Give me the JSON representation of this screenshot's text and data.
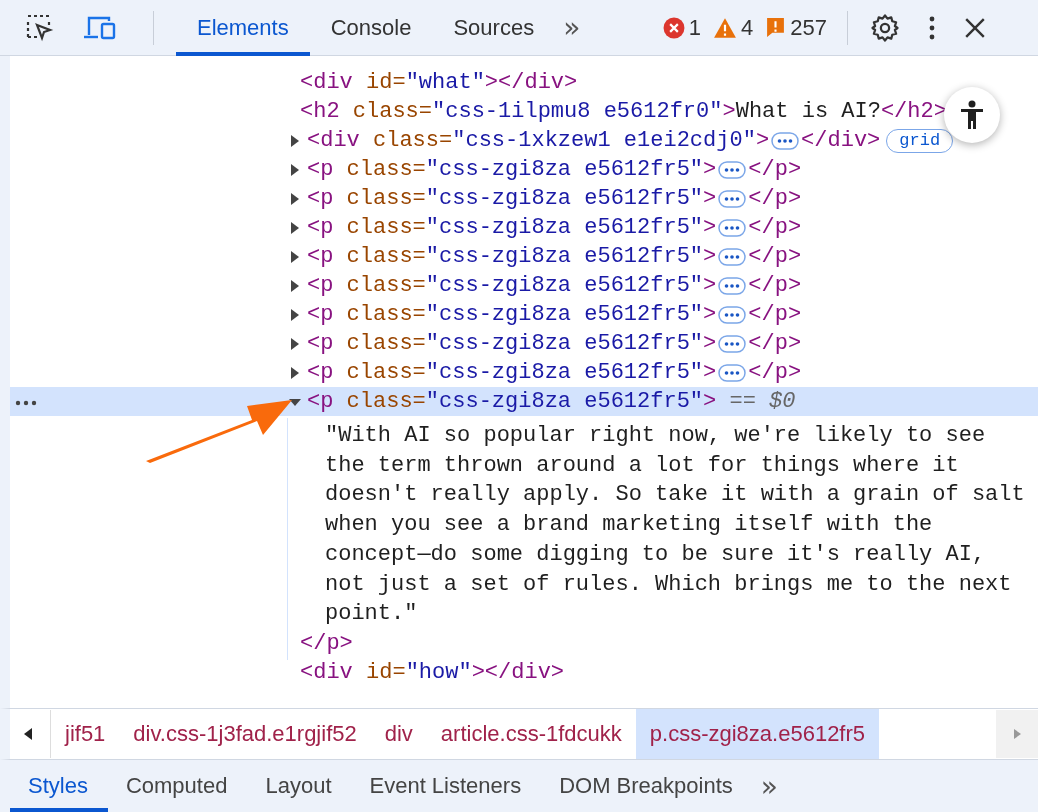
{
  "toolbar": {
    "tabs": [
      {
        "label": "Elements",
        "selected": true
      },
      {
        "label": "Console",
        "selected": false
      },
      {
        "label": "Sources",
        "selected": false
      }
    ],
    "more": "»",
    "errors": "1",
    "warnings": "4",
    "issues": "257"
  },
  "dom_lines": [
    {
      "kind": "element",
      "selected": false,
      "tokens": [
        {
          "kind": "tag",
          "s": "<div"
        },
        {
          "kind": "attr",
          "s": " id="
        },
        {
          "kind": "value",
          "s": "\"what\""
        },
        {
          "kind": "tag",
          "s": "></div>"
        }
      ]
    },
    {
      "kind": "element",
      "selected": false,
      "tokens": [
        {
          "kind": "tag",
          "s": "<h2"
        },
        {
          "kind": "attr",
          "s": " class="
        },
        {
          "kind": "value",
          "s": "\"css-1ilpmu8 e5612fr0\""
        },
        {
          "kind": "tag",
          "s": ">"
        },
        {
          "kind": "text",
          "s": "What is AI?"
        },
        {
          "kind": "tag",
          "s": "</h2>"
        }
      ]
    },
    {
      "kind": "element",
      "selected": false,
      "expanded": false,
      "tokens": [
        {
          "kind": "tag",
          "s": "<div"
        },
        {
          "kind": "attr",
          "s": " class="
        },
        {
          "kind": "value",
          "s": "\"css-1xkzew1 e1ei2cdj0\""
        },
        {
          "kind": "tag",
          "s": ">"
        },
        {
          "kind": "ellipsis"
        },
        {
          "kind": "tag",
          "s": "</div>"
        },
        {
          "kind": "badge",
          "s": "grid"
        }
      ]
    },
    {
      "kind": "element",
      "selected": false,
      "expanded": false,
      "tokens": [
        {
          "kind": "tag",
          "s": "<p"
        },
        {
          "kind": "attr",
          "s": " class="
        },
        {
          "kind": "value",
          "s": "\"css-zgi8za e5612fr5\""
        },
        {
          "kind": "tag",
          "s": ">"
        },
        {
          "kind": "ellipsis"
        },
        {
          "kind": "tag",
          "s": "</p>"
        }
      ]
    },
    {
      "kind": "element",
      "selected": false,
      "expanded": false,
      "tokens": [
        {
          "kind": "tag",
          "s": "<p"
        },
        {
          "kind": "attr",
          "s": " class="
        },
        {
          "kind": "value",
          "s": "\"css-zgi8za e5612fr5\""
        },
        {
          "kind": "tag",
          "s": ">"
        },
        {
          "kind": "ellipsis"
        },
        {
          "kind": "tag",
          "s": "</p>"
        }
      ]
    },
    {
      "kind": "element",
      "selected": false,
      "expanded": false,
      "tokens": [
        {
          "kind": "tag",
          "s": "<p"
        },
        {
          "kind": "attr",
          "s": " class="
        },
        {
          "kind": "value",
          "s": "\"css-zgi8za e5612fr5\""
        },
        {
          "kind": "tag",
          "s": ">"
        },
        {
          "kind": "ellipsis"
        },
        {
          "kind": "tag",
          "s": "</p>"
        }
      ]
    },
    {
      "kind": "element",
      "selected": false,
      "expanded": false,
      "tokens": [
        {
          "kind": "tag",
          "s": "<p"
        },
        {
          "kind": "attr",
          "s": " class="
        },
        {
          "kind": "value",
          "s": "\"css-zgi8za e5612fr5\""
        },
        {
          "kind": "tag",
          "s": ">"
        },
        {
          "kind": "ellipsis"
        },
        {
          "kind": "tag",
          "s": "</p>"
        }
      ]
    },
    {
      "kind": "element",
      "selected": false,
      "expanded": false,
      "tokens": [
        {
          "kind": "tag",
          "s": "<p"
        },
        {
          "kind": "attr",
          "s": " class="
        },
        {
          "kind": "value",
          "s": "\"css-zgi8za e5612fr5\""
        },
        {
          "kind": "tag",
          "s": ">"
        },
        {
          "kind": "ellipsis"
        },
        {
          "kind": "tag",
          "s": "</p>"
        }
      ]
    },
    {
      "kind": "element",
      "selected": false,
      "expanded": false,
      "tokens": [
        {
          "kind": "tag",
          "s": "<p"
        },
        {
          "kind": "attr",
          "s": " class="
        },
        {
          "kind": "value",
          "s": "\"css-zgi8za e5612fr5\""
        },
        {
          "kind": "tag",
          "s": ">"
        },
        {
          "kind": "ellipsis"
        },
        {
          "kind": "tag",
          "s": "</p>"
        }
      ]
    },
    {
      "kind": "element",
      "selected": false,
      "expanded": false,
      "tokens": [
        {
          "kind": "tag",
          "s": "<p"
        },
        {
          "kind": "attr",
          "s": " class="
        },
        {
          "kind": "value",
          "s": "\"css-zgi8za e5612fr5\""
        },
        {
          "kind": "tag",
          "s": ">"
        },
        {
          "kind": "ellipsis"
        },
        {
          "kind": "tag",
          "s": "</p>"
        }
      ]
    },
    {
      "kind": "element",
      "selected": false,
      "expanded": false,
      "tokens": [
        {
          "kind": "tag",
          "s": "<p"
        },
        {
          "kind": "attr",
          "s": " class="
        },
        {
          "kind": "value",
          "s": "\"css-zgi8za e5612fr5\""
        },
        {
          "kind": "tag",
          "s": ">"
        },
        {
          "kind": "ellipsis"
        },
        {
          "kind": "tag",
          "s": "</p>"
        }
      ]
    },
    {
      "kind": "element",
      "selected": true,
      "expanded": true,
      "tokens": [
        {
          "kind": "tag",
          "s": "<p"
        },
        {
          "kind": "attr",
          "s": " class="
        },
        {
          "kind": "value",
          "s": "\"css-zgi8za e5612fr5\""
        },
        {
          "kind": "tag",
          "s": ">"
        },
        {
          "kind": "hint",
          "s": " == "
        },
        {
          "kind": "var",
          "s": "$0"
        }
      ]
    },
    {
      "kind": "text",
      "lines": [
        "\"With AI so popular right now, we're likely to see",
        "the term thrown around a lot for things where it",
        "doesn't really apply. So take it with a grain of salt",
        "when you see a brand marketing itself with the",
        "concept—do some digging to be sure it's really AI,",
        "not just a set of rules. Which brings me to the next",
        "point.\""
      ]
    },
    {
      "kind": "element",
      "selected": false,
      "tokens": [
        {
          "kind": "tag",
          "s": "</p>"
        }
      ]
    },
    {
      "kind": "element",
      "selected": false,
      "tokens": [
        {
          "kind": "tag",
          "s": "<div"
        },
        {
          "kind": "attr",
          "s": " id="
        },
        {
          "kind": "value",
          "s": "\"how\""
        },
        {
          "kind": "tag",
          "s": "></div>"
        }
      ]
    }
  ],
  "breadcrumbs": [
    {
      "label": "jif51",
      "selected": false
    },
    {
      "label": "div.css-1j3fad.e1rgjif52",
      "selected": false
    },
    {
      "label": "div",
      "selected": false
    },
    {
      "label": "article.css-1fdcukk",
      "selected": false
    },
    {
      "label": "p.css-zgi8za.e5612fr5",
      "selected": true
    }
  ],
  "panel_tabs": [
    {
      "label": "Styles",
      "selected": true
    },
    {
      "label": "Computed",
      "selected": false
    },
    {
      "label": "Layout",
      "selected": false
    },
    {
      "label": "Event Listeners",
      "selected": false
    },
    {
      "label": "DOM Breakpoints",
      "selected": false
    }
  ],
  "panel_more": "»"
}
